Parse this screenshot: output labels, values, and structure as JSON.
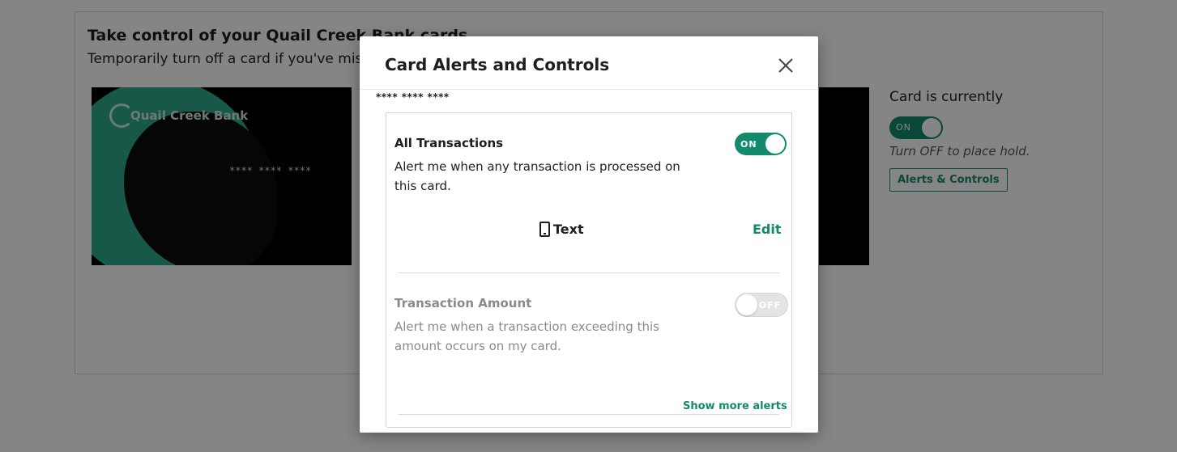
{
  "background": {
    "title": "Take control of your Quail Creek Bank cards",
    "subtitle": "Temporarily turn off a card if you've misp",
    "card": {
      "bank_name": "Quail Creek Bank",
      "number_masked": "**** **** ****"
    },
    "status": {
      "label": "Card is currently",
      "toggle_label": "ON",
      "hint": "Turn OFF to place hold.",
      "button_label": "Alerts & Controls"
    }
  },
  "modal": {
    "title": "Card Alerts and Controls",
    "close_icon": "close-icon",
    "card_number_masked": "**** **** ****",
    "alerts": [
      {
        "title": "All Transactions",
        "description": "Alert me when any transaction is processed on this card.",
        "enabled": true,
        "toggle_label": "ON",
        "channel_label": "Text",
        "channel_icon": "mobile-phone-icon",
        "edit_label": "Edit"
      },
      {
        "title": "Transaction Amount",
        "description": "Alert me when a transaction exceeding this amount occurs on my card.",
        "enabled": false,
        "toggle_label": "OFF"
      }
    ],
    "show_more_label": "Show more alerts"
  },
  "colors": {
    "accent": "#138a6c",
    "card_teal": "#2fa98d"
  }
}
